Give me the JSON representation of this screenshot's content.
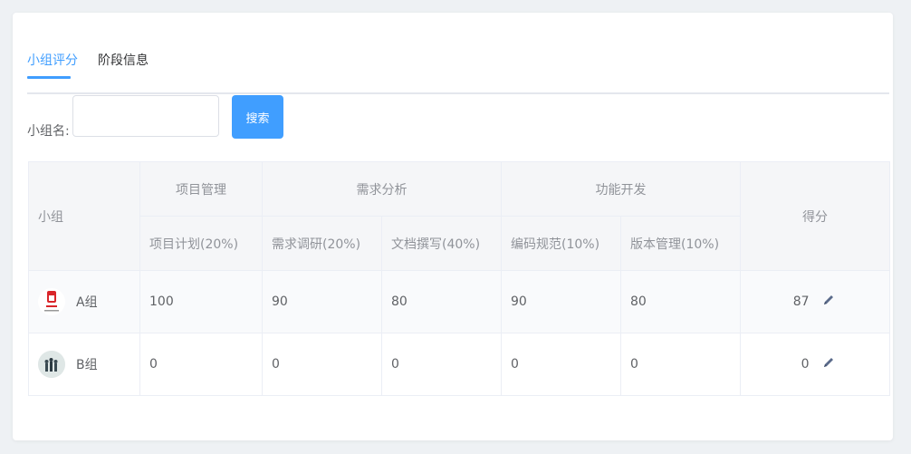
{
  "tabs": [
    {
      "label": "小组评分",
      "active": true
    },
    {
      "label": "阶段信息",
      "active": false
    }
  ],
  "search": {
    "label": "小组名:",
    "value": "",
    "placeholder": "",
    "button_label": "搜索"
  },
  "table": {
    "group_header": "小组",
    "score_header": "得分",
    "groups": [
      {
        "label": "项目管理",
        "columns": [
          "项目计划(20%)"
        ]
      },
      {
        "label": "需求分析",
        "columns": [
          "需求调研(20%)",
          "文档撰写(40%)"
        ]
      },
      {
        "label": "功能开发",
        "columns": [
          "编码规范(10%)",
          "版本管理(10%)"
        ]
      }
    ],
    "rows": [
      {
        "name": "A组",
        "avatar": "group-a-logo",
        "values": [
          "100",
          "90",
          "80",
          "90",
          "80"
        ],
        "score": "87"
      },
      {
        "name": "B组",
        "avatar": "group-b-photo",
        "values": [
          "0",
          "0",
          "0",
          "0",
          "0"
        ],
        "score": "0"
      }
    ]
  },
  "colors": {
    "primary": "#409eff",
    "header_bg": "#f5f6f8",
    "border": "#ebeef5"
  }
}
